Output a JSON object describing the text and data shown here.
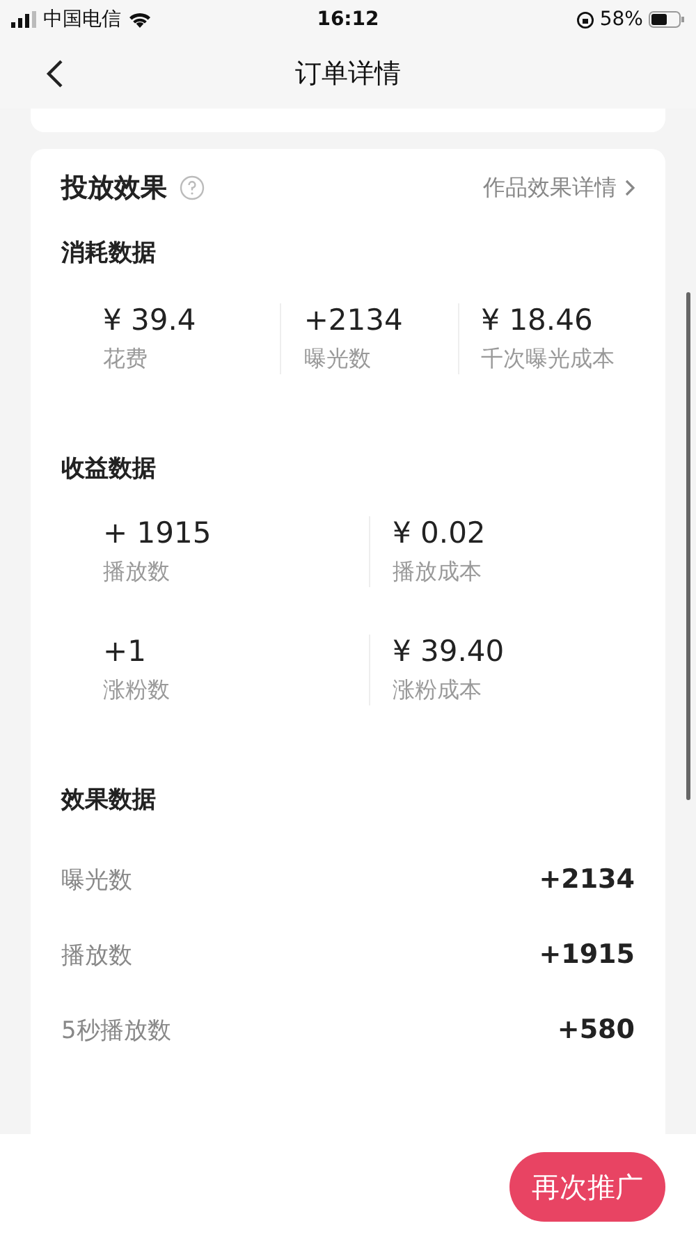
{
  "status_bar": {
    "carrier": "中国电信",
    "time": "16:12",
    "battery": "58%"
  },
  "nav": {
    "title": "订单详情"
  },
  "card": {
    "title": "投放效果",
    "link": "作品效果详情"
  },
  "sections": [
    {
      "kind": "stats3",
      "title": "消耗数据",
      "stats": [
        {
          "value": "¥ 39.4",
          "label": "花费"
        },
        {
          "value": "+2134",
          "label": "曝光数"
        },
        {
          "value": "¥ 18.46",
          "label": "千次曝光成本"
        }
      ]
    },
    {
      "kind": "grid2",
      "title": "收益数据",
      "stats": [
        {
          "value": "+ 1915",
          "label": "播放数"
        },
        {
          "value": "¥ 0.02",
          "label": "播放成本"
        },
        {
          "value": "+1",
          "label": "涨粉数"
        },
        {
          "value": "¥ 39.40",
          "label": "涨粉成本"
        }
      ]
    },
    {
      "kind": "rows",
      "title": "效果数据",
      "rows": [
        {
          "label": "曝光数",
          "value": "+2134"
        },
        {
          "label": "播放数",
          "value": "+1915"
        },
        {
          "label": "5秒播放数",
          "value": "+580"
        }
      ]
    }
  ],
  "button": "再次推广"
}
